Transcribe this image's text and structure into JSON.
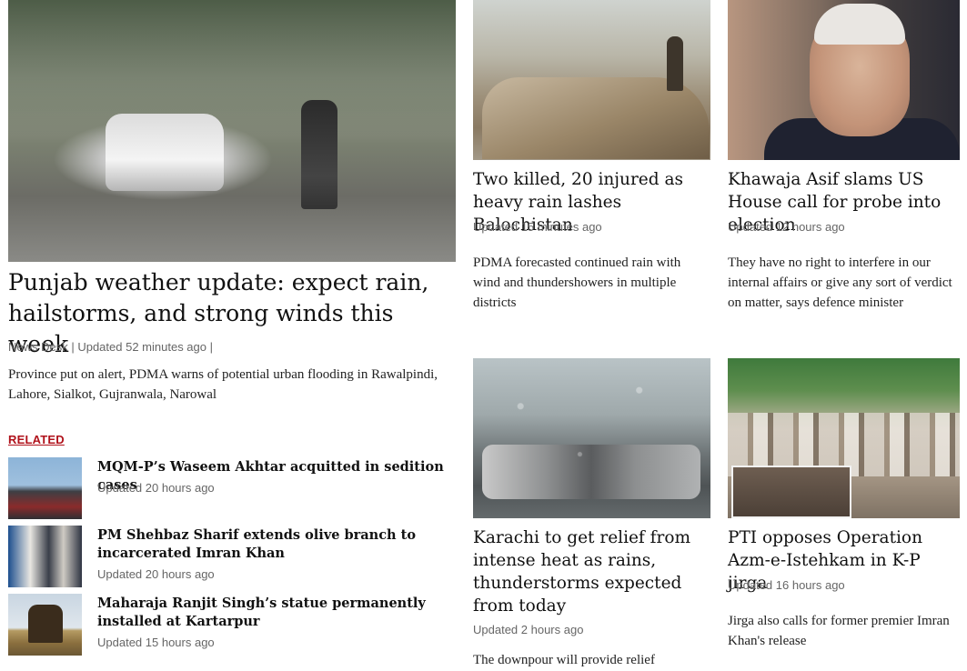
{
  "lead": {
    "image_alt": "Man cycling and car driving in heavy rain",
    "title": "Punjab weather update: expect rain, hailstorms, and strong winds this week",
    "meta": "News Desk | Updated 52 minutes ago |",
    "excerpt": "Province put on alert, PDMA warns of potential urban flooding in Rawalpindi, Lahore, Sialkot, Gujranwala, Narowal"
  },
  "related": {
    "label": "RELATED",
    "items": [
      {
        "title": "MQM-P’s Waseem Akhtar acquitted in sedition cases",
        "meta": "Updated 20 hours ago"
      },
      {
        "title": "PM Shehbaz Sharif extends olive branch to incarcerated Imran Khan",
        "meta": "Updated 20 hours ago"
      },
      {
        "title": "Maharaja Ranjit Singh’s statue permanently installed at Kartarpur",
        "meta": "Updated 15 hours ago"
      }
    ]
  },
  "stories": [
    {
      "title": "Two killed, 20 injured as heavy rain lashes Balochistan",
      "meta": "Updated 15 minutes ago",
      "excerpt": "PDMA forecasted continued rain with wind and thundershowers in multiple districts"
    },
    {
      "title": "Khawaja Asif slams US House call for probe into election",
      "meta": "Updated 12 hours ago",
      "excerpt": "They have no right to interfere in our internal affairs or give any sort of verdict on matter, says defence minister"
    },
    {
      "title": "Karachi to get relief from intense heat as rains, thunderstorms expected from today",
      "meta": "Updated 2 hours ago",
      "excerpt": "The downpour will provide relief"
    },
    {
      "title": "PTI opposes Operation Azm-e-Istehkam in K-P jirga",
      "meta": "Updated 16 hours ago",
      "excerpt": "Jirga also calls for former premier Imran Khan's release"
    }
  ]
}
